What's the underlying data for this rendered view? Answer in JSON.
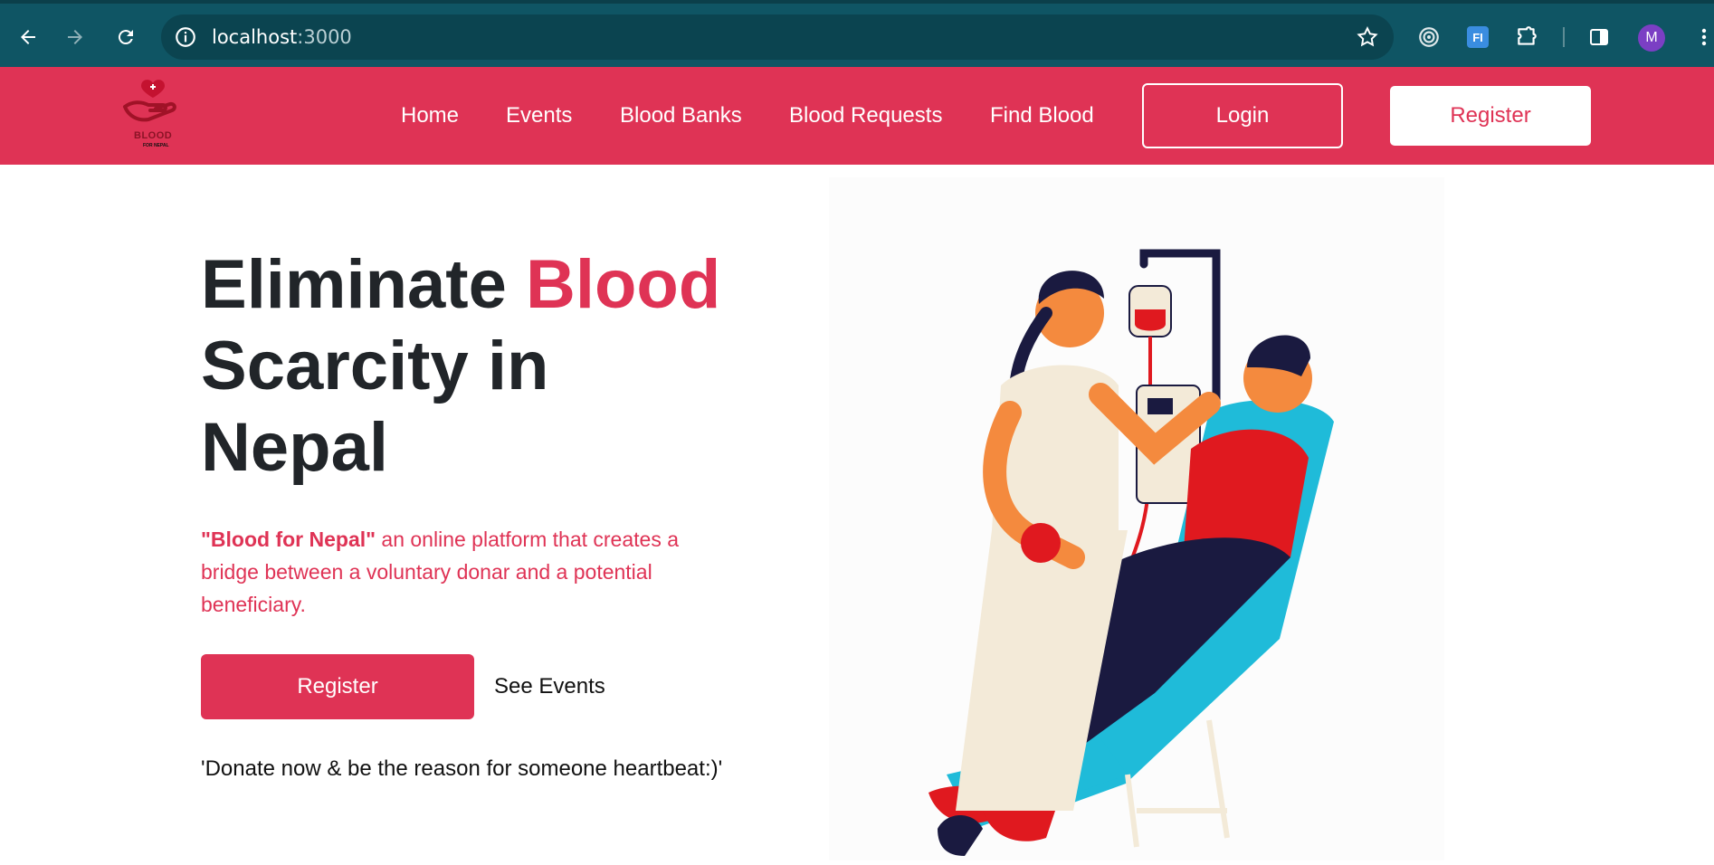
{
  "browser": {
    "url_host": "localhost",
    "url_port": ":3000",
    "avatar_letter": "M",
    "extension_label": "FI"
  },
  "header": {
    "logo_text": "BLOOD",
    "logo_subtext": "FOR NEPAL",
    "nav": [
      "Home",
      "Events",
      "Blood Banks",
      "Blood Requests",
      "Find Blood"
    ],
    "login_label": "Login",
    "register_label": "Register"
  },
  "hero": {
    "title_part1": "Eliminate ",
    "title_accent": "Blood",
    "title_part2": "Scarcity in",
    "title_part3": "Nepal",
    "desc_bold": "\"Blood for Nepal\"",
    "desc_rest": " an online platform that creates a bridge between a voluntary donar and a potential beneficiary.",
    "register_label": "Register",
    "see_events_label": "See Events",
    "tagline": "'Donate now & be the reason for someone heartbeat:)'"
  },
  "icons": {
    "back": "arrow-left-icon",
    "forward": "arrow-right-icon",
    "reload": "reload-icon",
    "info": "info-icon",
    "star": "star-icon"
  },
  "colors": {
    "brand": "#df3355",
    "chrome": "#0f5564",
    "text_dark": "#212529"
  }
}
